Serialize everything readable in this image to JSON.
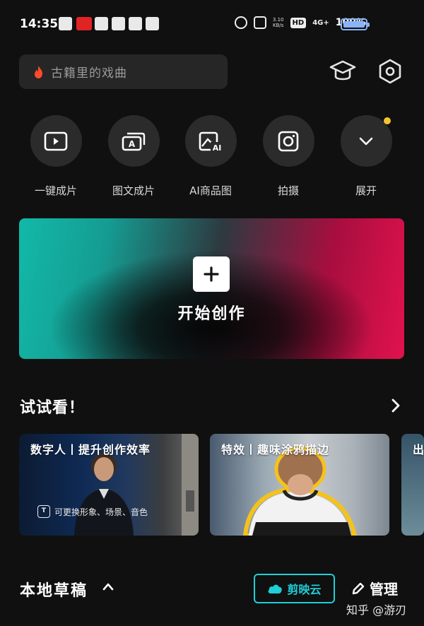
{
  "status_bar": {
    "time": "14:35",
    "net_speed": "3.10",
    "net_unit": "KB/s",
    "hd": "HD",
    "network": "4G+",
    "battery": "100%"
  },
  "search": {
    "placeholder": "古籍里的戏曲"
  },
  "quick_actions": [
    {
      "label": "一键成片",
      "icon": "play-video-icon"
    },
    {
      "label": "图文成片",
      "icon": "text-cards-icon"
    },
    {
      "label": "AI商品图",
      "icon": "ai-image-icon"
    },
    {
      "label": "拍摄",
      "icon": "camera-icon"
    },
    {
      "label": "展开",
      "icon": "chevron-down-icon"
    }
  ],
  "start": {
    "label": "开始创作"
  },
  "try_section": {
    "title": "试试看！",
    "cards": [
      {
        "title": "数字人丨提升创作效率",
        "subtitle": "可更换形象、场景、音色"
      },
      {
        "title": "特效丨趣味涂鸦描边"
      },
      {
        "title": "出"
      }
    ]
  },
  "drafts": {
    "title": "本地草稿",
    "cloud_label": "剪映云",
    "manage_label": "管理"
  },
  "watermark": "知乎 @游刃",
  "colors": {
    "background": "#101010",
    "accent_cyan": "#1ecfd8",
    "notify_dot": "#f4c430"
  }
}
